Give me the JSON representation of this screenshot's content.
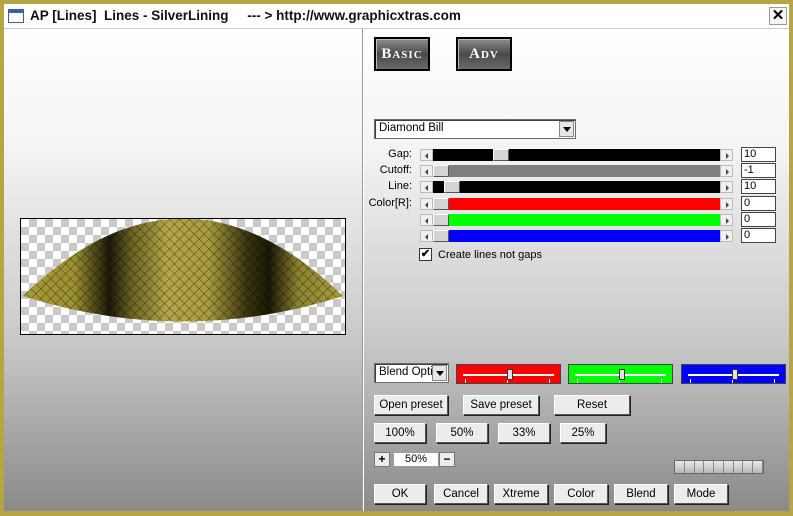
{
  "window": {
    "title": "AP [Lines]  Lines - SilverLining     --- > http://www.graphicxtras.com",
    "close_glyph": "✕"
  },
  "tabs": {
    "basic": "Basic",
    "adv": "Adv"
  },
  "preset_dropdown": {
    "value": "Diamond Bill"
  },
  "controls": [
    {
      "label": "Gap:",
      "value": "10",
      "track_color": "#000000",
      "thumb_fraction": 0.22
    },
    {
      "label": "Cutoff:",
      "value": "-1",
      "track_color": "#7f7f7f",
      "thumb_fraction": 0.0
    },
    {
      "label": "Line:",
      "value": "10",
      "track_color": "#000000",
      "thumb_fraction": 0.04
    },
    {
      "label": "Color[R]:",
      "value": "0",
      "track_color": "#ff0000",
      "thumb_fraction": 0.0
    },
    {
      "label": "",
      "value": "0",
      "track_color": "#00ff00",
      "thumb_fraction": 0.0
    },
    {
      "label": "",
      "value": "0",
      "track_color": "#0000ff",
      "thumb_fraction": 0.0
    }
  ],
  "checkbox": {
    "label": "Create lines not gaps",
    "checked": true,
    "mark": "✔"
  },
  "blend": {
    "dropdown_value": "Blend Optic"
  },
  "mini_sliders": [
    {
      "color": "#ff0000",
      "fraction": 0.5
    },
    {
      "color": "#00ff00",
      "fraction": 0.5
    },
    {
      "color": "#0000ff",
      "fraction": 0.5
    }
  ],
  "preset_buttons": {
    "open": "Open preset",
    "save": "Save preset",
    "reset": "Reset"
  },
  "zoom_buttons": [
    "100%",
    "50%",
    "33%",
    "25%"
  ],
  "zoom": {
    "plus": "+",
    "minus": "−",
    "value": "50%"
  },
  "bottom_buttons": [
    "OK",
    "Cancel",
    "Xtreme",
    "Color",
    "Blend",
    "Mode"
  ]
}
